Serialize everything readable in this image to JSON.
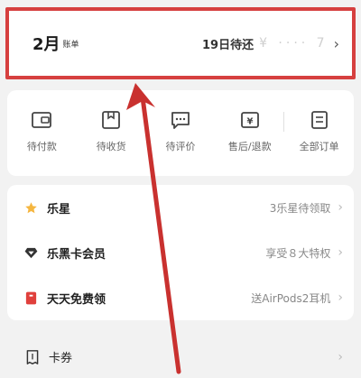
{
  "bill": {
    "month": "2月",
    "sub_label": "账单",
    "due_text": "19日待还",
    "amount_masked": "¥ ···· 7"
  },
  "orders": [
    {
      "label": "待付款",
      "icon": "wallet-icon"
    },
    {
      "label": "待收货",
      "icon": "package-icon"
    },
    {
      "label": "待评价",
      "icon": "comment-icon"
    },
    {
      "label": "售后/退款",
      "icon": "refund-icon"
    },
    {
      "label": "全部订单",
      "icon": "order-list-icon"
    }
  ],
  "list": [
    {
      "title": "乐星",
      "right": "3乐星待领取",
      "icon": "star-icon",
      "icon_color": "#f5b640"
    },
    {
      "title": "乐黑卡会员",
      "right": "享受８大特权",
      "icon": "diamond-icon",
      "icon_color": "#333333"
    },
    {
      "title": "天天免费领",
      "right": "送AirPods2耳机",
      "icon": "gift-icon",
      "icon_color": "#e0403c"
    }
  ],
  "coupon": {
    "title": "卡券",
    "icon": "coupon-icon"
  },
  "colors": {
    "highlight": "#d6403f",
    "arrow": "#c9312f"
  }
}
